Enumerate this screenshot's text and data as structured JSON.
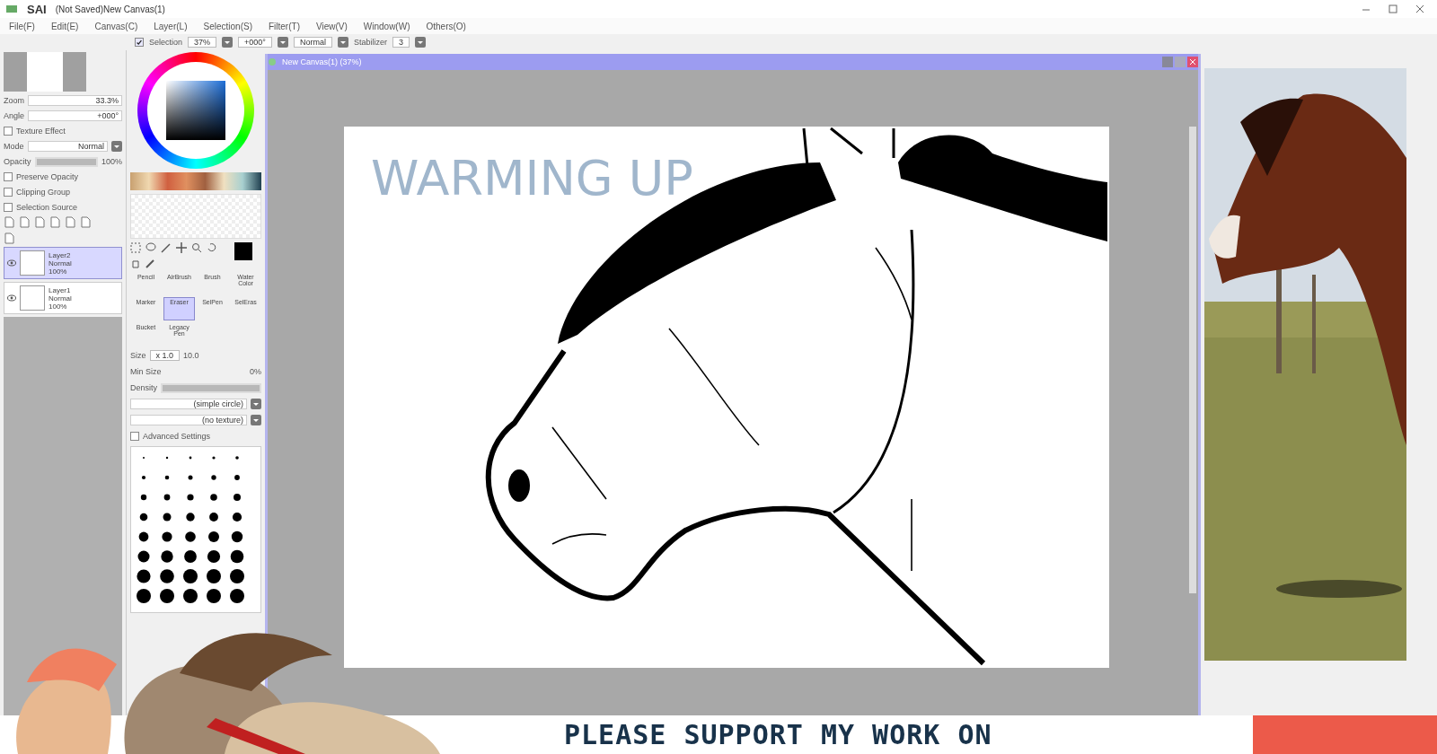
{
  "window": {
    "logo_text": "SAI",
    "title": "(Not Saved)New Canvas(1)"
  },
  "menu": [
    "File(F)",
    "Edit(E)",
    "Canvas(C)",
    "Layer(L)",
    "Selection(S)",
    "Filter(T)",
    "View(V)",
    "Window(W)",
    "Others(O)"
  ],
  "toolbar": {
    "selection_checked": true,
    "selection_label": "Selection",
    "zoom": "37%",
    "angle": "+000°",
    "mode": "Normal",
    "stabilizer_label": "Stabilizer",
    "stabilizer": "3"
  },
  "navigator": {
    "zoom_label": "Zoom",
    "zoom": "33.3%",
    "angle_label": "Angle",
    "angle": "+000°"
  },
  "layer_props": {
    "effect_label": "Texture Effect",
    "effect_checked": false,
    "mode_label": "Mode",
    "mode": "Normal",
    "opacity_label": "Opacity",
    "opacity": "100%",
    "opacity_slider": {
      "level": 1.0
    },
    "options": [
      {
        "label": "Preserve Opacity",
        "checked": false
      },
      {
        "label": "Clipping Group",
        "checked": false
      },
      {
        "label": "Selection Source",
        "checked": false
      }
    ]
  },
  "layers": [
    {
      "name": "Layer2",
      "mode": "Normal",
      "opacity": "100%",
      "selected": true
    },
    {
      "name": "Layer1",
      "mode": "Normal",
      "opacity": "100%",
      "selected": false
    }
  ],
  "tools": [
    {
      "label": "Pencil",
      "selected": false
    },
    {
      "label": "AirBrush",
      "selected": false
    },
    {
      "label": "Brush",
      "selected": false
    },
    {
      "label": "Water Color",
      "selected": false
    },
    {
      "label": "Marker",
      "selected": false
    },
    {
      "label": "Eraser",
      "selected": true
    },
    {
      "label": "SelPen",
      "selected": false
    },
    {
      "label": "SelEras",
      "selected": false
    },
    {
      "label": "Bucket",
      "selected": false
    },
    {
      "label": "Legacy Pen",
      "selected": false
    }
  ],
  "brush": {
    "size_label": "Size",
    "size_multiplier": "x 1.0",
    "size": "10.0",
    "min_size_label": "Min Size",
    "min_size": "0%",
    "density_label": "Density",
    "density_slider": {
      "level": 1.0
    },
    "shape": "(simple circle)",
    "texture": "(no texture)",
    "advanced_label": "Advanced Settings",
    "advanced_checked": false
  },
  "canvas_window": {
    "title": "New Canvas(1) (37%)"
  },
  "canvas": {
    "caption": "WARMING UP"
  },
  "banner": {
    "text": "PLEASE SUPPORT MY WORK ON"
  }
}
